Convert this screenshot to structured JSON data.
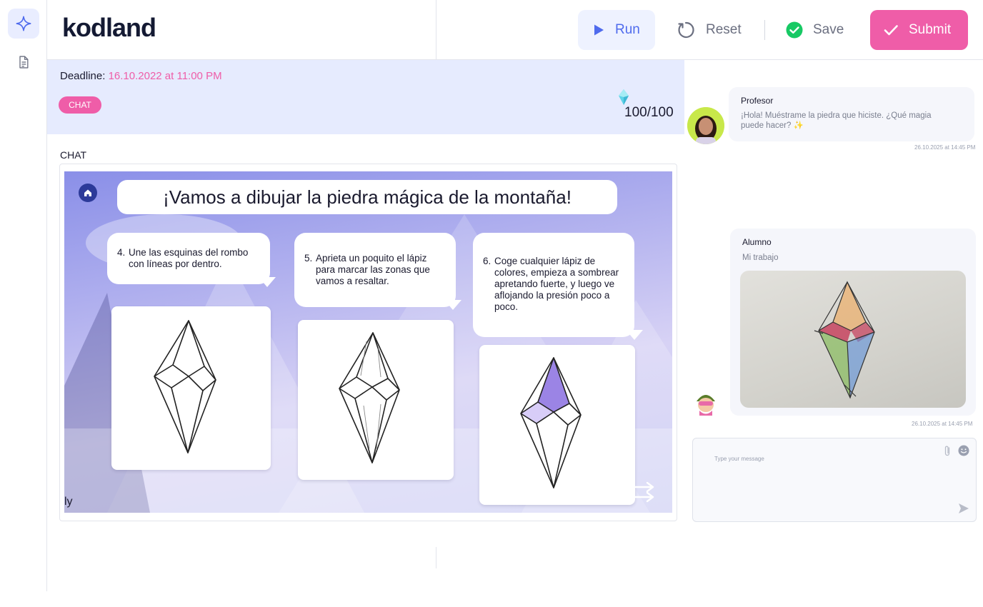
{
  "brand": {
    "name": "kodland"
  },
  "sidebar": {
    "items": [
      {
        "icon": "sparkle-icon",
        "active": true
      },
      {
        "icon": "document-icon",
        "active": false
      }
    ]
  },
  "toolbar": {
    "run_label": "Run",
    "reset_label": "Reset",
    "save_label": "Save",
    "submit_label": "Submit"
  },
  "task": {
    "deadline_label": "Deadline:",
    "deadline_value": "16.10.2022 at 11:00 PM",
    "tag": "CHAT",
    "score": "100/100",
    "section_label": "CHAT"
  },
  "activity": {
    "title": "¡Vamos a dibujar la piedra mágica de la montaña!",
    "steps": [
      {
        "number": "4.",
        "text": "Une las esquinas del rombo con líneas por dentro."
      },
      {
        "number": "5.",
        "text": "Aprieta un poquito el lápiz para marcar las zonas que vamos a resaltar."
      },
      {
        "number": "6.",
        "text": "Coge cualquier lápiz de colores, empieza a sombrear apretando fuerte, y luego ve aflojando la presión poco a poco."
      }
    ],
    "corner_text": "ly"
  },
  "chat": {
    "messages": [
      {
        "sender": "Profesor",
        "text": "¡Hola! Muéstrame la piedra que hiciste. ¿Qué magia puede hacer? ✨",
        "time": "26.10.2025 at 14:45 PM"
      },
      {
        "sender": "Alumno",
        "text": "Mi trabajo",
        "time": "26.10.2025 at 14:45 PM"
      }
    ],
    "composer_placeholder": "Type your message"
  },
  "colors": {
    "accent": "#ef5da8",
    "primary": "#4f6bed",
    "banner": "#e6ebfe",
    "success": "#17c964"
  }
}
